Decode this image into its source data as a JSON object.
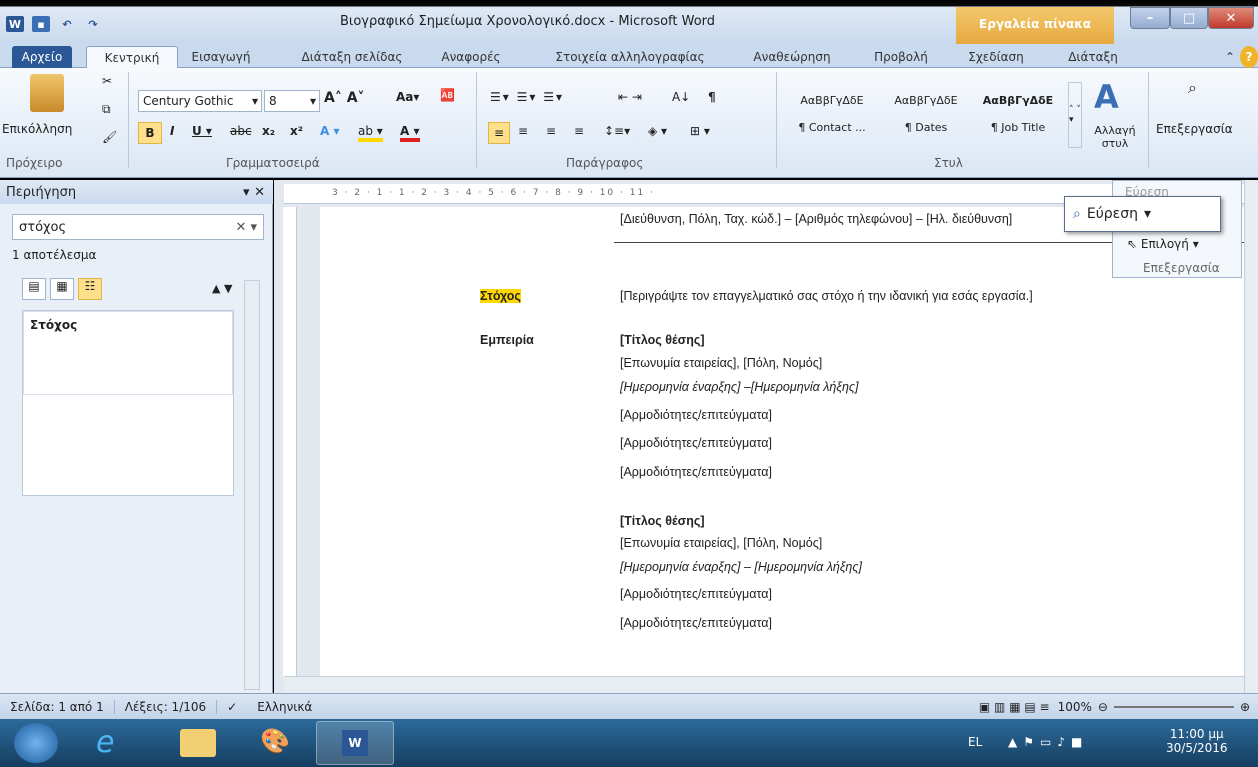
{
  "window": {
    "title": "Βιογραφικό Σημείωμα Χρονολογικό.docx - Microsoft Word",
    "contextual_tools": "Εργαλεία πίνακα"
  },
  "tabs": [
    "Αρχείο",
    "Κεντρική",
    "Εισαγωγή",
    "Διάταξη σελίδας",
    "Αναφορές",
    "Στοιχεία αλληλογραφίας",
    "Αναθεώρηση",
    "Προβολή",
    "Σχεδίαση",
    "Διάταξη"
  ],
  "ribbon": {
    "clipboard": {
      "paste": "Επικόλληση",
      "label": "Πρόχειρο"
    },
    "font": {
      "name": "Century Gothic",
      "size": "8",
      "label": "Γραμματοσειρά"
    },
    "paragraph": {
      "label": "Παράγραφος"
    },
    "styles": {
      "items": [
        {
          "preview": "ΑαΒβΓγΔδΕ",
          "name": "¶ Contact ..."
        },
        {
          "preview": "ΑαΒβΓγΔδΕ",
          "name": "¶ Dates"
        },
        {
          "preview": "ΑαΒβΓγΔδΕ",
          "name": "¶ Job Title"
        }
      ],
      "change": "Αλλαγή στυλ",
      "label": "Στυλ"
    },
    "editing": {
      "label": "Επεξεργασία"
    }
  },
  "nav": {
    "title": "Περιήγηση",
    "search_value": "στόχος",
    "result_count": "1 αποτέλεσμα",
    "result_item": "Στόχος"
  },
  "find_panel": {
    "find_top": "Εύρεση",
    "find": "Εύρεση",
    "select": "Επιλογή",
    "label": "Επεξεργασία"
  },
  "document": {
    "contact_line": "[Διεύθυνση, Πόλη, Ταχ. κώδ.] – [Αριθμός τηλεφώνου] – [Ηλ. διεύθυνση]",
    "objective_label": "Στόχος",
    "objective_text": "[Περιγράψτε τον επαγγελματικό σας στόχο ή την ιδανική για εσάς εργασία.]",
    "experience_label": "Εμπειρία",
    "job1": {
      "title": "[Τίτλος θέσης]",
      "company": "[Επωνυμία εταιρείας], [Πόλη, Νομός]",
      "dates": "[Ημερομηνία έναρξης] –[Ημερομηνία λήξης]",
      "duties": [
        "[Αρμοδιότητες/επιτεύγματα]",
        "[Αρμοδιότητες/επιτεύγματα]",
        "[Αρμοδιότητες/επιτεύγματα]"
      ]
    },
    "job2": {
      "title": "[Τίτλος θέσης]",
      "company": "[Επωνυμία εταιρείας], [Πόλη, Νομός]",
      "dates": "[Ημερομηνία έναρξης] – [Ημερομηνία λήξης]",
      "duties": [
        "[Αρμοδιότητες/επιτεύγματα]",
        "[Αρμοδιότητες/επιτεύγματα]"
      ]
    }
  },
  "status": {
    "page": "Σελίδα: 1 από 1",
    "words": "Λέξεις: 1/106",
    "language": "Ελληνικά",
    "zoom": "100%"
  },
  "taskbar": {
    "lang": "EL",
    "time": "11:00 μμ",
    "date": "30/5/2016"
  },
  "colors": {
    "highlight": "#ffd800",
    "file_tab": "#2b5797",
    "contextual": "#e6a93f"
  }
}
